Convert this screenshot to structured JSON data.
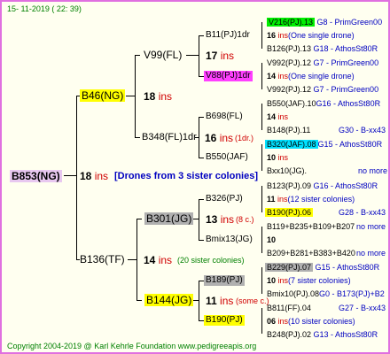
{
  "header": {
    "date": "15- 11-2019 ( 22: 39)"
  },
  "footer": {
    "copyright": "Copyright 2004-2019 @ Karl Kehrle Foundation   www.pedigreeapis.org"
  },
  "colors": {
    "border": "#e070e0",
    "background": "#fffff0",
    "ins": "#d00000",
    "green": "#008000",
    "blue": "#0000c0",
    "yellow": "#ffff00",
    "magenta": "#ff40ff",
    "cyan": "#00e0ff",
    "gray": "#b0b0b0",
    "bright_green": "#00ee00"
  },
  "root": {
    "label": "B853(NG)",
    "ins_num": "18",
    "ins": "ins",
    "note": "[Drones from 3 sister colonies]"
  },
  "g1": [
    {
      "label": "B46(NG)",
      "ins_num": "18",
      "ins": "ins"
    },
    {
      "label": "B136(TF)",
      "ins_num": "14",
      "ins": "ins",
      "note": "(20 sister colonies)"
    }
  ],
  "g2": [
    {
      "label": "V99(FL)",
      "ins_num": "17",
      "ins": "ins"
    },
    {
      "label": "B348(FL)1dr",
      "ins_num": "16",
      "ins": "ins",
      "note": "(1dr.)"
    },
    {
      "label": "B301(JG)",
      "ins_num": "13",
      "ins": "ins",
      "note": "(8 c.)"
    },
    {
      "label": "B144(JG)",
      "ins_num": "11",
      "ins": "ins",
      "note": "(some c.)"
    }
  ],
  "g3": [
    {
      "label": "B11(PJ)1dr",
      "ins_num": "17",
      "ins": "ins"
    },
    {
      "label": "V88(PJ)1dr",
      "ins_num": "14",
      "ins": "ins"
    },
    {
      "label": "B698(FL)",
      "ins_num": "14",
      "ins": "ins"
    },
    {
      "label": "B550(JAF)",
      "ins_num": "10",
      "ins": "ins"
    },
    {
      "label": "B326(PJ)",
      "ins_num": "11",
      "ins": "ins"
    },
    {
      "label": "Bmix13(JG)",
      "ins_num": "10",
      "ins": ""
    },
    {
      "label": "B189(PJ)",
      "ins_num": "10",
      "ins": "ins"
    },
    {
      "label": "B190(PJ)",
      "ins_num": "06",
      "ins": "ins"
    }
  ],
  "g4": [
    {
      "label": "V216(PJ).13",
      "info": "G8 - PrimGreen00"
    },
    {
      "label": "16",
      "ins": "ins",
      "note": "(One single drone)"
    },
    {
      "label": "B126(PJ).13",
      "info": "G18 - AthosSt80R"
    },
    {
      "label": "V992(PJ).12",
      "info": "G7 - PrimGreen00"
    },
    {
      "label": "14",
      "ins": "ins",
      "note": "(One single drone)"
    },
    {
      "label": "V992(PJ).12",
      "info": "G7 - PrimGreen00"
    },
    {
      "label": "B550(JAF).10",
      "info": "G16 - AthosSt80R"
    },
    {
      "label": "14",
      "ins": "ins"
    },
    {
      "label": "B148(PJ).11",
      "info": "G30 - B-xx43"
    },
    {
      "label": "B320(JAF).08",
      "info": "G15 - AthosSt80R"
    },
    {
      "label": "10",
      "ins": "ins"
    },
    {
      "label": "Bxx10(JG).",
      "info": "no more"
    },
    {
      "label": "B123(PJ).09",
      "info": "G16 - AthosSt80R"
    },
    {
      "label": "11",
      "ins": "ins",
      "note": "(12 sister colonies)"
    },
    {
      "label": "B190(PJ).06",
      "info": "G28 - B-xx43"
    },
    {
      "label": "B119+B235+B109+B207",
      "info": "no more"
    },
    {
      "label": "10"
    },
    {
      "label": "B209+B281+B383+B420",
      "info": "no more"
    },
    {
      "label": "B229(PJ).07",
      "info": "G15 - AthosSt80R"
    },
    {
      "label": "10",
      "ins": "ins",
      "note": "(7 sister colonies)"
    },
    {
      "label": "Bmix10(PJ).08",
      "info": "G0 - B173(PJ)+B2"
    },
    {
      "label": "B811(FF).04",
      "info": "G27 - B-xx43"
    },
    {
      "label": "06",
      "ins": "ins",
      "note": "(10 sister colonies)"
    },
    {
      "label": "B248(PJ).02",
      "info": "G13 - AthosSt80R"
    }
  ]
}
